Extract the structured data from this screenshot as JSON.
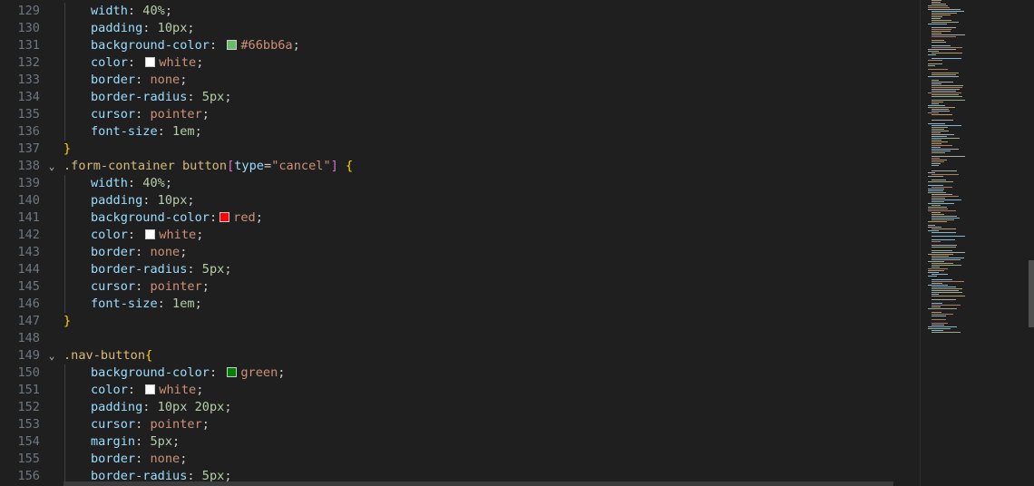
{
  "editor": {
    "lines": [
      {
        "num": "129",
        "tokens": [
          {
            "t": "width",
            "c": "prop"
          },
          {
            "t": ": ",
            "c": "punc"
          },
          {
            "t": "40%",
            "c": "num"
          },
          {
            "t": ";",
            "c": "punc"
          }
        ]
      },
      {
        "num": "130",
        "tokens": [
          {
            "t": "padding",
            "c": "prop"
          },
          {
            "t": ": ",
            "c": "punc"
          },
          {
            "t": "10px",
            "c": "num"
          },
          {
            "t": ";",
            "c": "punc"
          }
        ]
      },
      {
        "num": "131",
        "tokens": [
          {
            "t": "background-color",
            "c": "prop"
          },
          {
            "t": ": ",
            "c": "punc"
          },
          {
            "swatch": "#66bb6a"
          },
          {
            "t": "#66bb6a",
            "c": "str"
          },
          {
            "t": ";",
            "c": "punc"
          }
        ]
      },
      {
        "num": "132",
        "tokens": [
          {
            "t": "color",
            "c": "prop"
          },
          {
            "t": ": ",
            "c": "punc"
          },
          {
            "swatch": "#ffffff"
          },
          {
            "t": "white",
            "c": "kw"
          },
          {
            "t": ";",
            "c": "punc"
          }
        ]
      },
      {
        "num": "133",
        "tokens": [
          {
            "t": "border",
            "c": "prop"
          },
          {
            "t": ": ",
            "c": "punc"
          },
          {
            "t": "none",
            "c": "kw"
          },
          {
            "t": ";",
            "c": "punc"
          }
        ]
      },
      {
        "num": "134",
        "tokens": [
          {
            "t": "border-radius",
            "c": "prop"
          },
          {
            "t": ": ",
            "c": "punc"
          },
          {
            "t": "5px",
            "c": "num"
          },
          {
            "t": ";",
            "c": "punc"
          }
        ]
      },
      {
        "num": "135",
        "tokens": [
          {
            "t": "cursor",
            "c": "prop"
          },
          {
            "t": ": ",
            "c": "punc"
          },
          {
            "t": "pointer",
            "c": "kw"
          },
          {
            "t": ";",
            "c": "punc"
          }
        ]
      },
      {
        "num": "136",
        "tokens": [
          {
            "t": "font-size",
            "c": "prop"
          },
          {
            "t": ": ",
            "c": "punc"
          },
          {
            "t": "1em",
            "c": "num"
          },
          {
            "t": ";",
            "c": "punc"
          }
        ]
      },
      {
        "num": "137",
        "indent": 0,
        "tokens": [
          {
            "t": "}",
            "c": "brace"
          }
        ]
      },
      {
        "num": "138",
        "indent": 0,
        "fold": true,
        "tokens": [
          {
            "t": ".form-container button",
            "c": "sel"
          },
          {
            "t": "[",
            "c": "bracket"
          },
          {
            "t": "type",
            "c": "attr"
          },
          {
            "t": "=",
            "c": "punc"
          },
          {
            "t": "\"cancel\"",
            "c": "str"
          },
          {
            "t": "]",
            "c": "bracket"
          },
          {
            "t": " ",
            "c": "punc"
          },
          {
            "t": "{",
            "c": "brace"
          }
        ]
      },
      {
        "num": "139",
        "tokens": [
          {
            "t": "width",
            "c": "prop"
          },
          {
            "t": ": ",
            "c": "punc"
          },
          {
            "t": "40%",
            "c": "num"
          },
          {
            "t": ";",
            "c": "punc"
          }
        ]
      },
      {
        "num": "140",
        "tokens": [
          {
            "t": "padding",
            "c": "prop"
          },
          {
            "t": ": ",
            "c": "punc"
          },
          {
            "t": "10px",
            "c": "num"
          },
          {
            "t": ";",
            "c": "punc"
          }
        ]
      },
      {
        "num": "141",
        "tokens": [
          {
            "t": "background-color",
            "c": "prop"
          },
          {
            "t": ":",
            "c": "punc"
          },
          {
            "swatch": "#ff0000"
          },
          {
            "t": "red",
            "c": "kw"
          },
          {
            "t": ";",
            "c": "punc"
          }
        ]
      },
      {
        "num": "142",
        "tokens": [
          {
            "t": "color",
            "c": "prop"
          },
          {
            "t": ": ",
            "c": "punc"
          },
          {
            "swatch": "#ffffff"
          },
          {
            "t": "white",
            "c": "kw"
          },
          {
            "t": ";",
            "c": "punc"
          }
        ]
      },
      {
        "num": "143",
        "tokens": [
          {
            "t": "border",
            "c": "prop"
          },
          {
            "t": ": ",
            "c": "punc"
          },
          {
            "t": "none",
            "c": "kw"
          },
          {
            "t": ";",
            "c": "punc"
          }
        ]
      },
      {
        "num": "144",
        "tokens": [
          {
            "t": "border-radius",
            "c": "prop"
          },
          {
            "t": ": ",
            "c": "punc"
          },
          {
            "t": "5px",
            "c": "num"
          },
          {
            "t": ";",
            "c": "punc"
          }
        ]
      },
      {
        "num": "145",
        "tokens": [
          {
            "t": "cursor",
            "c": "prop"
          },
          {
            "t": ": ",
            "c": "punc"
          },
          {
            "t": "pointer",
            "c": "kw"
          },
          {
            "t": ";",
            "c": "punc"
          }
        ]
      },
      {
        "num": "146",
        "tokens": [
          {
            "t": "font-size",
            "c": "prop"
          },
          {
            "t": ": ",
            "c": "punc"
          },
          {
            "t": "1em",
            "c": "num"
          },
          {
            "t": ";",
            "c": "punc"
          }
        ]
      },
      {
        "num": "147",
        "indent": 0,
        "tokens": [
          {
            "t": "}",
            "c": "brace"
          }
        ]
      },
      {
        "num": "148",
        "indent": 0,
        "tokens": []
      },
      {
        "num": "149",
        "indent": 0,
        "fold": true,
        "tokens": [
          {
            "t": ".nav-button",
            "c": "sel"
          },
          {
            "t": "{",
            "c": "brace"
          }
        ]
      },
      {
        "num": "150",
        "tokens": [
          {
            "t": "background-color",
            "c": "prop"
          },
          {
            "t": ": ",
            "c": "punc"
          },
          {
            "swatch": "#008000"
          },
          {
            "t": "green",
            "c": "kw"
          },
          {
            "t": ";",
            "c": "punc"
          }
        ]
      },
      {
        "num": "151",
        "tokens": [
          {
            "t": "color",
            "c": "prop"
          },
          {
            "t": ": ",
            "c": "punc"
          },
          {
            "swatch": "#ffffff"
          },
          {
            "t": "white",
            "c": "kw"
          },
          {
            "t": ";",
            "c": "punc"
          }
        ]
      },
      {
        "num": "152",
        "tokens": [
          {
            "t": "padding",
            "c": "prop"
          },
          {
            "t": ": ",
            "c": "punc"
          },
          {
            "t": "10px 20px",
            "c": "num"
          },
          {
            "t": ";",
            "c": "punc"
          }
        ]
      },
      {
        "num": "153",
        "tokens": [
          {
            "t": "cursor",
            "c": "prop"
          },
          {
            "t": ": ",
            "c": "punc"
          },
          {
            "t": "pointer",
            "c": "kw"
          },
          {
            "t": ";",
            "c": "punc"
          }
        ]
      },
      {
        "num": "154",
        "tokens": [
          {
            "t": "margin",
            "c": "prop"
          },
          {
            "t": ": ",
            "c": "punc"
          },
          {
            "t": "5px",
            "c": "num"
          },
          {
            "t": ";",
            "c": "punc"
          }
        ]
      },
      {
        "num": "155",
        "tokens": [
          {
            "t": "border",
            "c": "prop"
          },
          {
            "t": ": ",
            "c": "punc"
          },
          {
            "t": "none",
            "c": "kw"
          },
          {
            "t": ";",
            "c": "punc"
          }
        ]
      },
      {
        "num": "156",
        "tokens": [
          {
            "t": "border-radius",
            "c": "prop"
          },
          {
            "t": ": ",
            "c": "punc"
          },
          {
            "t": "5px",
            "c": "num"
          },
          {
            "t": ";",
            "c": "punc"
          }
        ]
      }
    ]
  },
  "colors": {
    "background": "#1f1f1f",
    "line_number": "#6e7681",
    "selector": "#d7ba7d",
    "property": "#9cdcfe",
    "number": "#b5cea8",
    "string": "#ce9178",
    "brace": "#ffd700",
    "bracket": "#da70d6"
  }
}
